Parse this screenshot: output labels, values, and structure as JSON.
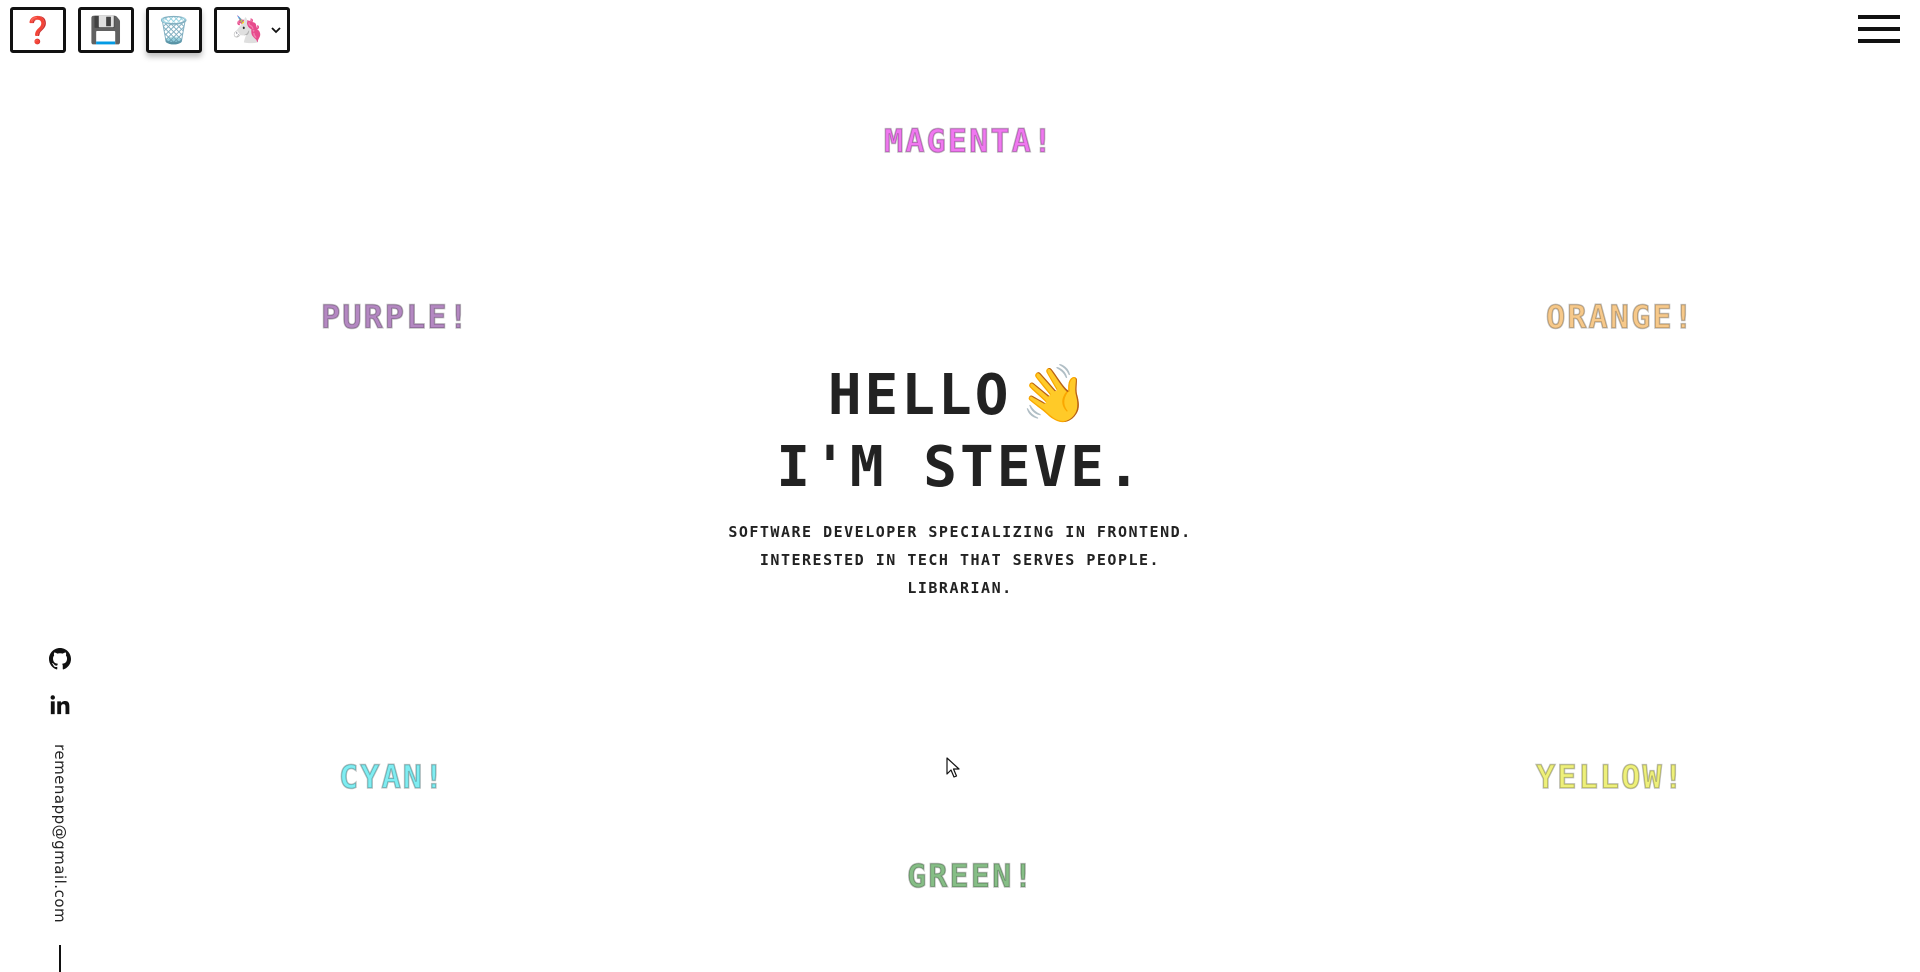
{
  "toolbar": {
    "help_icon": "question-mark-icon",
    "help_glyph": "❓",
    "save_icon": "floppy-disk-icon",
    "save_glyph": "💾",
    "clear_icon": "wastebasket-icon",
    "clear_glyph": "🗑️",
    "theme_icon": "unicorn-icon",
    "theme_glyph": "🦄",
    "theme_chevron": "⌄"
  },
  "menu": {
    "icon": "hamburger-menu-icon"
  },
  "color_words": {
    "magenta": {
      "label": "Magenta!",
      "color": "#F078F0"
    },
    "purple": {
      "label": "Purple!",
      "color": "#B488C2"
    },
    "orange": {
      "label": "Orange!",
      "color": "#F7C98A"
    },
    "cyan": {
      "label": "Cyan!",
      "color": "#7FEDF2"
    },
    "yellow": {
      "label": "Yellow!",
      "color": "#EEF07A"
    },
    "green": {
      "label": "Green!",
      "color": "#86BE86"
    }
  },
  "hero": {
    "line1": "Hello",
    "wave": "👋",
    "line2": "I'm Steve.",
    "tagline": [
      "Software developer specializing in frontend.",
      "Interested in tech that serves people.",
      "Librarian."
    ]
  },
  "social": {
    "github_icon": "github-icon",
    "linkedin_icon": "linkedin-icon",
    "email": "remenapp@gmail.com"
  }
}
